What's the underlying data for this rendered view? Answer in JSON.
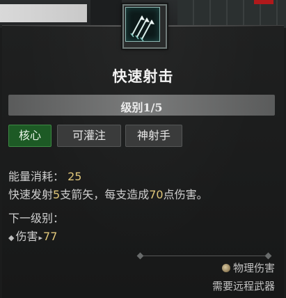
{
  "skill": {
    "name": "快速射击",
    "rank_label": "级别",
    "rank_value": "1/5",
    "tags": [
      "核心",
      "可灌注",
      "神射手"
    ],
    "resource_label": "能量消耗：",
    "resource_value": "25",
    "desc_part1": "快速发射",
    "desc_count": "5",
    "desc_part2": "支箭矢，每支造成",
    "desc_damage": "70",
    "desc_part3": "点伤害。",
    "next_rank_label": "下一级别：",
    "next_stat_label": "伤害",
    "next_stat_value": "77",
    "footer_damage_type": "物理伤害",
    "footer_requirement": "需要远程武器"
  },
  "colors": {
    "core_tag_bg": "#1d5a25",
    "highlight_value": "#e0c77a",
    "icon_glow": "#8fb9b4"
  },
  "icons": {
    "skill_icon": "triple-arrow-icon",
    "damage_icon": "fist-icon"
  }
}
